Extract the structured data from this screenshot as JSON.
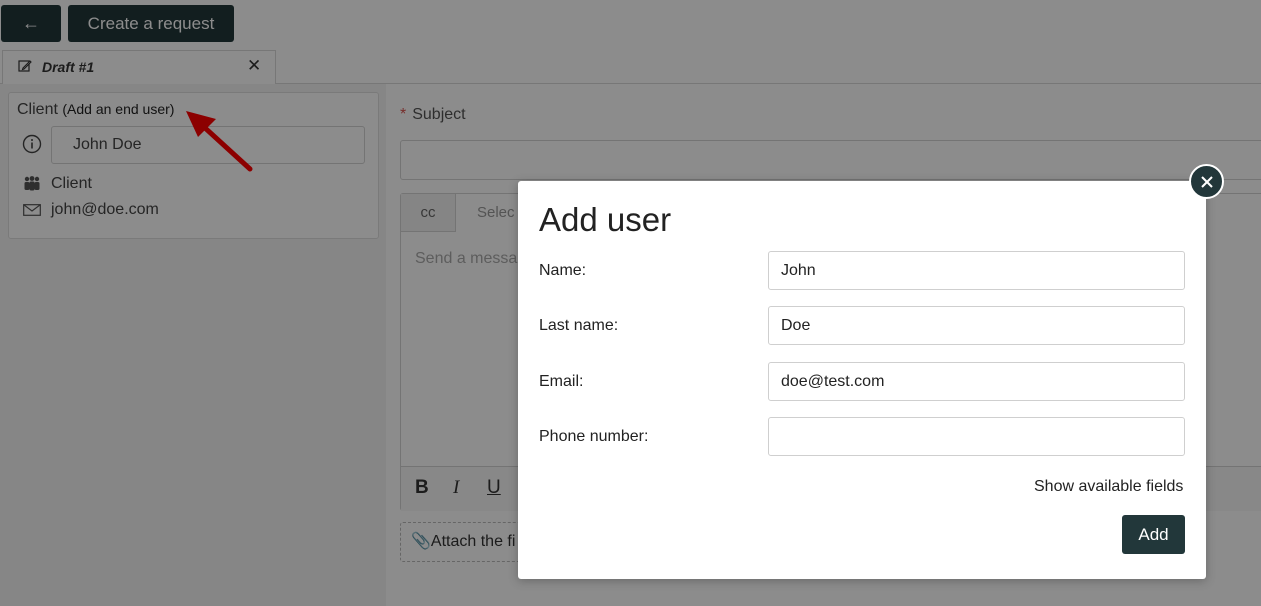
{
  "header": {
    "back_icon": "arrow-left-icon",
    "back_glyph": "←",
    "create_label": "Create a request"
  },
  "tab": {
    "icon": "edit-icon",
    "title": "Draft #1",
    "close_glyph": "✕"
  },
  "client": {
    "heading": "Client",
    "add_link": "(Add an end user)",
    "name": "John Doe",
    "role": "Client",
    "email": "john@doe.com"
  },
  "request": {
    "subject_required_mark": "*",
    "subject_label": "Subject",
    "subject_value": "",
    "cc_label": "cc",
    "select_placeholder": "Selec",
    "message_placeholder": "Send a messa",
    "toolbar": {
      "bold": "B",
      "italic": "I",
      "underline": "U"
    },
    "attach_label": "Attach the fi"
  },
  "modal": {
    "title": "Add user",
    "fields": [
      {
        "label": "Name:",
        "value": "John"
      },
      {
        "label": "Last name:",
        "value": "Doe"
      },
      {
        "label": "Email:",
        "value": "doe@test.com"
      },
      {
        "label": "Phone number:",
        "value": ""
      }
    ],
    "show_fields_label": "Show available fields",
    "add_label": "Add",
    "close_glyph": "✕"
  },
  "colors": {
    "dark": "#22373a",
    "required": "#d9534f",
    "arrow": "#ff0000"
  }
}
